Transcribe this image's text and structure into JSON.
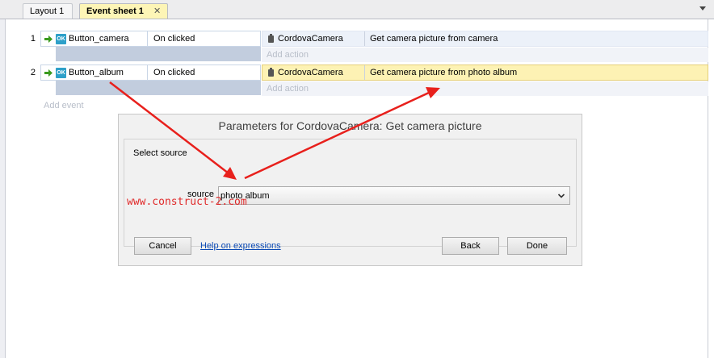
{
  "tabs": [
    {
      "label": "Layout 1",
      "active": false
    },
    {
      "label": "Event sheet 1",
      "active": true,
      "close_glyph": "✕"
    }
  ],
  "events": [
    {
      "number": "1",
      "condition": {
        "object": "Button_camera",
        "trigger": "On clicked",
        "icon": "button-object-icon"
      },
      "action": {
        "object": "CordovaCamera",
        "name": "Get camera picture from camera",
        "icon": "camera-plugin-icon"
      },
      "add_action": "Add action",
      "selected": false
    },
    {
      "number": "2",
      "condition": {
        "object": "Button_album",
        "trigger": "On clicked",
        "icon": "button-object-icon"
      },
      "action": {
        "object": "CordovaCamera",
        "name": "Get camera picture from photo album",
        "icon": "camera-plugin-icon"
      },
      "add_action": "Add action",
      "selected": true
    }
  ],
  "add_event": "Add event",
  "dialog": {
    "title": "Parameters for CordovaCamera: Get camera picture",
    "group_title": "Select source",
    "source_label": "source",
    "source_value": "photo album",
    "watermark": "www.construct-2.com",
    "buttons": {
      "cancel": "Cancel",
      "help": "Help on expressions",
      "back": "Back",
      "done": "Done"
    }
  },
  "colors": {
    "annotation_arrow": "#e8201c",
    "selected_tab": "#fdf5b6",
    "selected_action": "#fdf2b4"
  }
}
